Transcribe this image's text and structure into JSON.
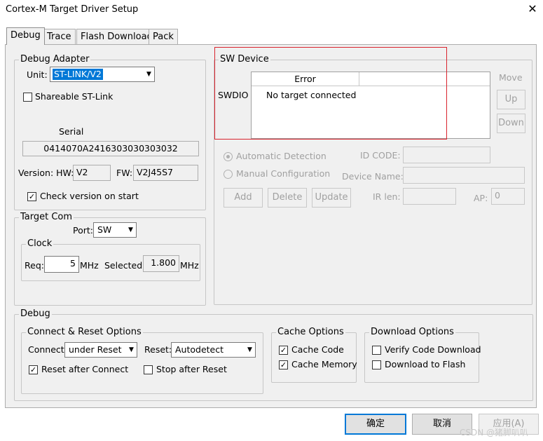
{
  "window": {
    "title": "Cortex-M Target Driver Setup",
    "close_glyph": "✕"
  },
  "tabs": [
    "Debug",
    "Trace",
    "Flash Download",
    "Pack"
  ],
  "debug_adapter": {
    "legend": "Debug Adapter",
    "unit_label": "Unit:",
    "unit_value": "ST-LINK/V2",
    "shareable_label": "Shareable ST-Link",
    "shareable_checked": false,
    "serial_label": "Serial",
    "serial_value": "0414070A2416303030303032",
    "version_label": "Version: HW:",
    "hw_value": "V2",
    "fw_label": "FW:",
    "fw_value": "V2J45S7",
    "check_version_label": "Check version on start",
    "check_version_checked": true
  },
  "target_com": {
    "legend": "Target Com",
    "port_label": "Port:",
    "port_value": "SW",
    "clock_legend": "Clock",
    "req_label": "Req:",
    "req_value": "5",
    "req_unit": "MHz",
    "selected_label": "Selected:",
    "selected_value": "1.800",
    "selected_unit": "MHz"
  },
  "sw_device": {
    "legend": "SW Device",
    "row_label": "SWDIO",
    "col_header": "Error",
    "message": "No target connected",
    "move_label": "Move",
    "up_label": "Up",
    "down_label": "Down",
    "auto_detect_label": "Automatic Detection",
    "auto_detect_selected": true,
    "manual_config_label": "Manual Configuration",
    "id_code_label": "ID CODE:",
    "device_name_label": "Device Name:",
    "add_label": "Add",
    "delete_label": "Delete",
    "update_label": "Update",
    "ir_len_label": "IR len:",
    "ap_label": "AP:",
    "ap_value": "0"
  },
  "debug": {
    "legend": "Debug",
    "connect_reset": {
      "legend": "Connect & Reset Options",
      "connect_label": "Connect:",
      "connect_value": "under Reset",
      "reset_label": "Reset:",
      "reset_value": "Autodetect",
      "reset_after_connect_label": "Reset after Connect",
      "reset_after_connect_checked": true,
      "stop_after_reset_label": "Stop after Reset",
      "stop_after_reset_checked": false
    },
    "cache": {
      "legend": "Cache Options",
      "cache_code_label": "Cache Code",
      "cache_code_checked": true,
      "cache_memory_label": "Cache Memory",
      "cache_memory_checked": true
    },
    "download": {
      "legend": "Download Options",
      "verify_label": "Verify Code Download",
      "verify_checked": false,
      "flash_label": "Download to Flash",
      "flash_checked": false
    }
  },
  "footer": {
    "ok_label": "确定",
    "cancel_label": "取消",
    "apply_label": "应用(A)",
    "watermark": "CSDN @猪脚叭叭"
  }
}
